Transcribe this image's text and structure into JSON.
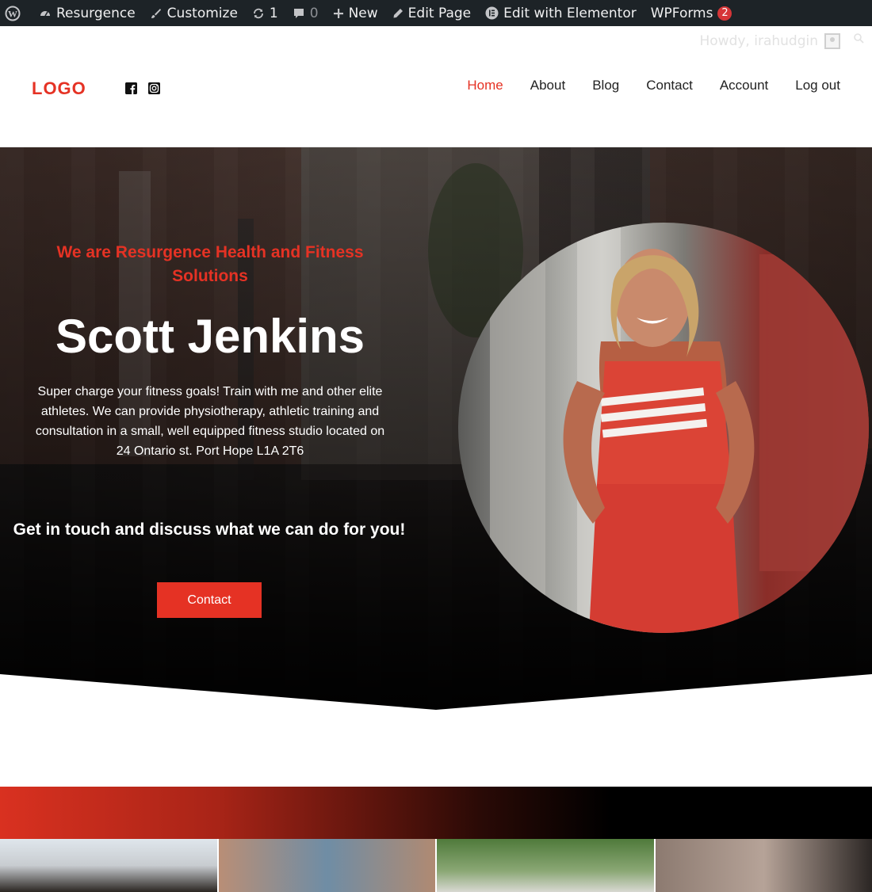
{
  "adminbar": {
    "site_name": "Resurgence",
    "customize": "Customize",
    "updates_count": "1",
    "comments_count": "0",
    "new": "New",
    "edit_page": "Edit Page",
    "edit_elementor": "Edit with Elementor",
    "wpforms": "WPForms",
    "wpforms_badge": "2"
  },
  "howdy": "Howdy, irahudgin",
  "header": {
    "logo": "LOGO",
    "nav": [
      {
        "label": "Home",
        "active": true
      },
      {
        "label": "About"
      },
      {
        "label": "Blog"
      },
      {
        "label": "Contact"
      },
      {
        "label": "Account"
      },
      {
        "label": "Log out"
      }
    ]
  },
  "hero": {
    "subtitle": "We are Resurgence Health and Fitness Solutions",
    "title": "Scott Jenkins",
    "description": "Super charge your fitness goals! Train with me and other elite athletes. We can provide physiotherapy, athletic training and consultation in a small, well equipped fitness studio located on 24 Ontario st. Port Hope L1A 2T6",
    "cta_text": "Get in touch and discuss what we can do for you!",
    "button": "Contact"
  },
  "colors": {
    "accent": "#e53224",
    "adminbar": "#1d2327"
  }
}
